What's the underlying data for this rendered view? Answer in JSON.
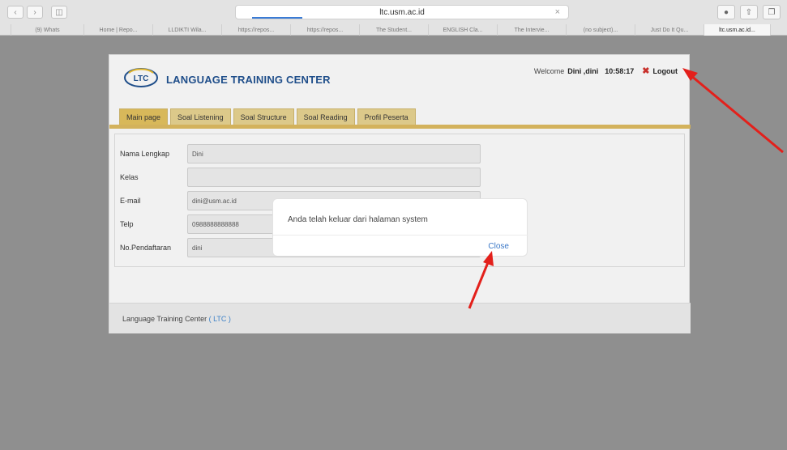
{
  "browser": {
    "url": "ltc.usm.ac.id",
    "tabs": [
      "(9) Whats",
      "Home | Repo...",
      "LLDIKTI Wila...",
      "https://repos...",
      "https://repos...",
      "The Student...",
      "ENGLISH Cla...",
      "The Intervie...",
      "(no subject)...",
      "Just Do It Qu...",
      "ltc.usm.ac.id..."
    ],
    "active_tab_index": 10
  },
  "header": {
    "brand": "LANGUAGE TRAINING CENTER",
    "logo_text": "LTC",
    "welcome_prefix": "Welcome",
    "user_name": "Dini ,dini",
    "clock": "10:58:17",
    "logout_label": "Logout"
  },
  "nav": {
    "items": [
      "Main page",
      "Soal Listening",
      "Soal Structure",
      "Soal Reading",
      "Profil Peserta"
    ],
    "active_index": 0
  },
  "form": {
    "fields": [
      {
        "label": "Nama Lengkap",
        "value": "Dini"
      },
      {
        "label": "Kelas",
        "value": ""
      },
      {
        "label": "E-mail",
        "value": "dini@usm.ac.id"
      },
      {
        "label": "Telp",
        "value": "0988888888888"
      },
      {
        "label": "No.Pendaftaran",
        "value": "dini"
      }
    ]
  },
  "footer": {
    "text": "Language Training Center",
    "ltc": "( LTC )"
  },
  "modal": {
    "message": "Anda telah keluar dari halaman system",
    "close_label": "Close"
  },
  "colors": {
    "annotation_red": "#e3201b",
    "nav_gold": "#d3b25c",
    "brand_blue": "#1f4e8a",
    "link_blue": "#3b78c7"
  }
}
